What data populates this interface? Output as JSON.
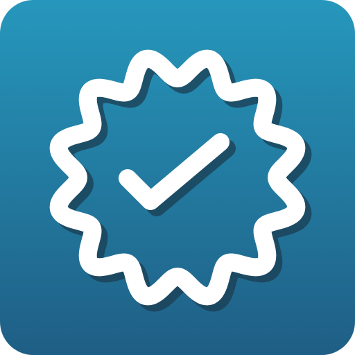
{
  "icon": {
    "name": "verified-badge-icon",
    "background_gradient": [
      "#2697BC",
      "#1F5E85"
    ],
    "badge_stroke_color": "#FFFFFF",
    "checkmark_color": "#FFFFFF",
    "shadow_color": "#1B3E52"
  }
}
